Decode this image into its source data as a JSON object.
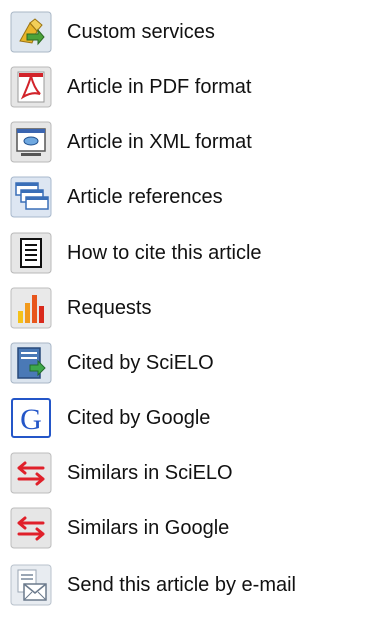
{
  "services": [
    {
      "label": "Custom services",
      "icon": "custom-services-icon"
    },
    {
      "label": "Article in PDF format",
      "icon": "pdf-icon"
    },
    {
      "label": "Article in XML format",
      "icon": "xml-icon"
    },
    {
      "label": "Article references",
      "icon": "references-icon"
    },
    {
      "label": "How to cite this article",
      "icon": "cite-icon"
    },
    {
      "label": "Requests",
      "icon": "requests-bar-chart-icon"
    },
    {
      "label": "Cited by SciELO",
      "icon": "cited-by-scielo-icon"
    },
    {
      "label": "Cited by Google",
      "icon": "google-icon"
    },
    {
      "label": "Similars in SciELO",
      "icon": "similars-arrows-icon"
    },
    {
      "label": "Similars in Google",
      "icon": "similars-arrows-icon"
    },
    {
      "label": "Send this article by e-mail",
      "icon": "email-icon"
    }
  ],
  "colors": {
    "text": "#111111",
    "similars_red": "#e0202a",
    "requests_orange": "#f29a1c",
    "google_blue": "#2456c8"
  }
}
